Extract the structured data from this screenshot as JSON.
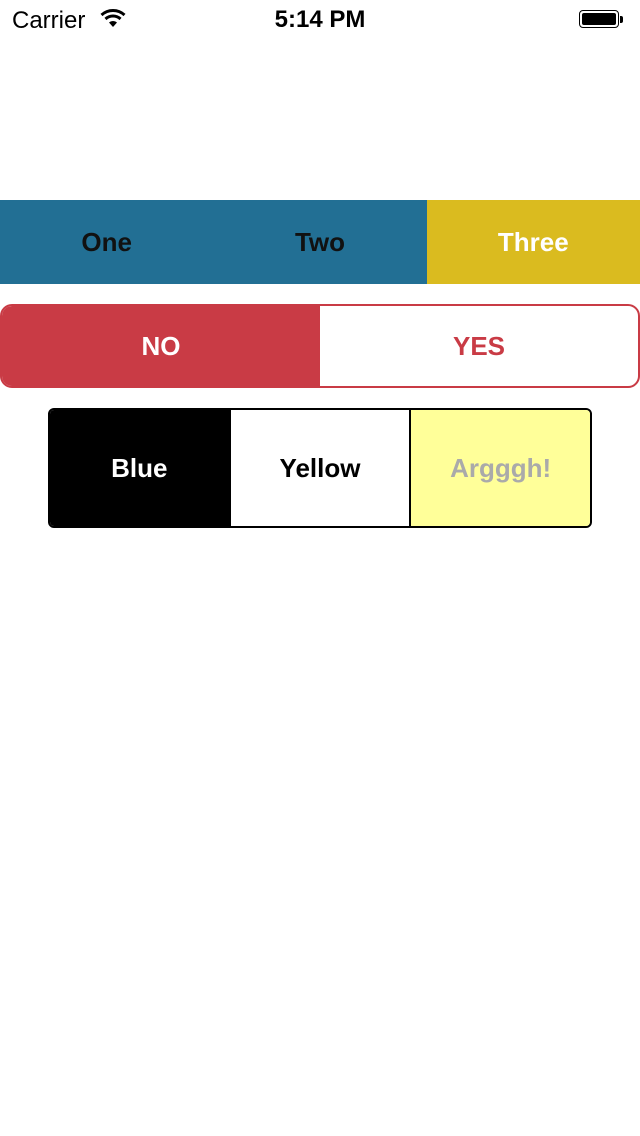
{
  "status_bar": {
    "carrier": "Carrier",
    "time": "5:14 PM",
    "wifi_icon": "wifi-icon",
    "battery_icon": "battery-icon",
    "battery_level": 1.0
  },
  "segment_one": {
    "items": [
      {
        "label": "One",
        "selected": false
      },
      {
        "label": "Two",
        "selected": false
      },
      {
        "label": "Three",
        "selected": true
      }
    ],
    "colors": {
      "background": "#226f94",
      "selected_background": "#dabb1f",
      "text": "#111111",
      "selected_text": "#ffffff"
    }
  },
  "segment_two": {
    "items": [
      {
        "label": "NO",
        "selected": true
      },
      {
        "label": "YES",
        "selected": false
      }
    ],
    "colors": {
      "tint": "#c93b45",
      "background": "#ffffff"
    }
  },
  "segment_three": {
    "items": [
      {
        "label": "Blue",
        "selected": true,
        "disabled": false
      },
      {
        "label": "Yellow",
        "selected": false,
        "disabled": false
      },
      {
        "label": "Argggh!",
        "selected": false,
        "disabled": true
      }
    ],
    "colors": {
      "selected_background": "#000000",
      "disabled_background": "#ffff99",
      "disabled_text": "#aaaaaa"
    }
  }
}
